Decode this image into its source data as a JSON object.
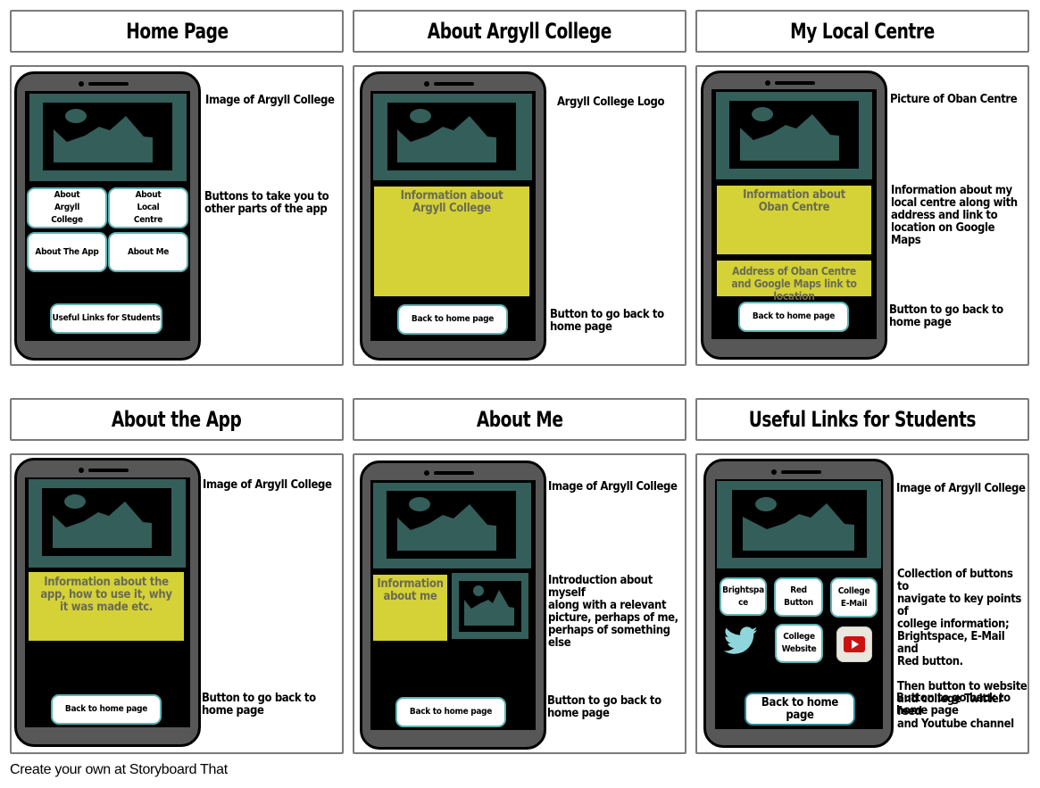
{
  "footer": "Create your own at Storyboard That",
  "colors": {
    "phone_body": "#575757",
    "image_frame": "#345e5a",
    "info_panel": "#d4d237",
    "info_text": "#6b6b55",
    "button_border": "#5fb3b3",
    "twitter": "#8fd6dc",
    "youtube_red": "#cc1111"
  },
  "panels": [
    {
      "title": "Home Page",
      "notes": [
        "Image of Argyll College",
        "Buttons to take you to\nother parts of the app"
      ],
      "buttons": [
        "About Argyll College",
        "About Local Centre",
        "About The App",
        "About Me",
        "Useful Links for Students"
      ]
    },
    {
      "title": "About Argyll College",
      "notes": [
        "Argyll College Logo",
        "Button to go back to\nhome page"
      ],
      "info": "Information about Argyll College",
      "back_button": "Back to home page"
    },
    {
      "title": "My Local Centre",
      "notes": [
        "Picture of Oban Centre",
        "Information about my\nlocal centre along with\naddress and link to\nlocation on Google Maps",
        "Button to go back to\nhome page"
      ],
      "info": "Information about Oban Centre",
      "address": "Address of Oban Centre and Google Maps link to location",
      "back_button": "Back to home page"
    },
    {
      "title": "About the App",
      "notes": [
        "Image of Argyll College",
        "Button to go back to\nhome page"
      ],
      "info": "Information about the app, how to use it, why it was made etc.",
      "back_button": "Back to home page"
    },
    {
      "title": "About Me",
      "notes": [
        "Image of Argyll College",
        "Introduction about myself\nalong with a relevant\npicture, perhaps of me,\nperhaps of something else",
        "Button to go back to\nhome page"
      ],
      "info": "Information about me",
      "back_button": "Back to home page"
    },
    {
      "title": "Useful Links for Students",
      "notes": [
        "Image of Argyll College",
        "Collection of buttons to\nnavigate to key points of\ncollege information;\nBrightspace, E-Mail and\nRed button.\n\nThen button to website\nand college Twitter feed\nand Youtube channel",
        "Button to go back to\nhome page"
      ],
      "buttons": [
        "Brightspa ce",
        "Red Button",
        "College E-Mail",
        "College Website"
      ],
      "icons": [
        "twitter-icon",
        "youtube-icon"
      ],
      "back_button": "Back to home page"
    }
  ]
}
